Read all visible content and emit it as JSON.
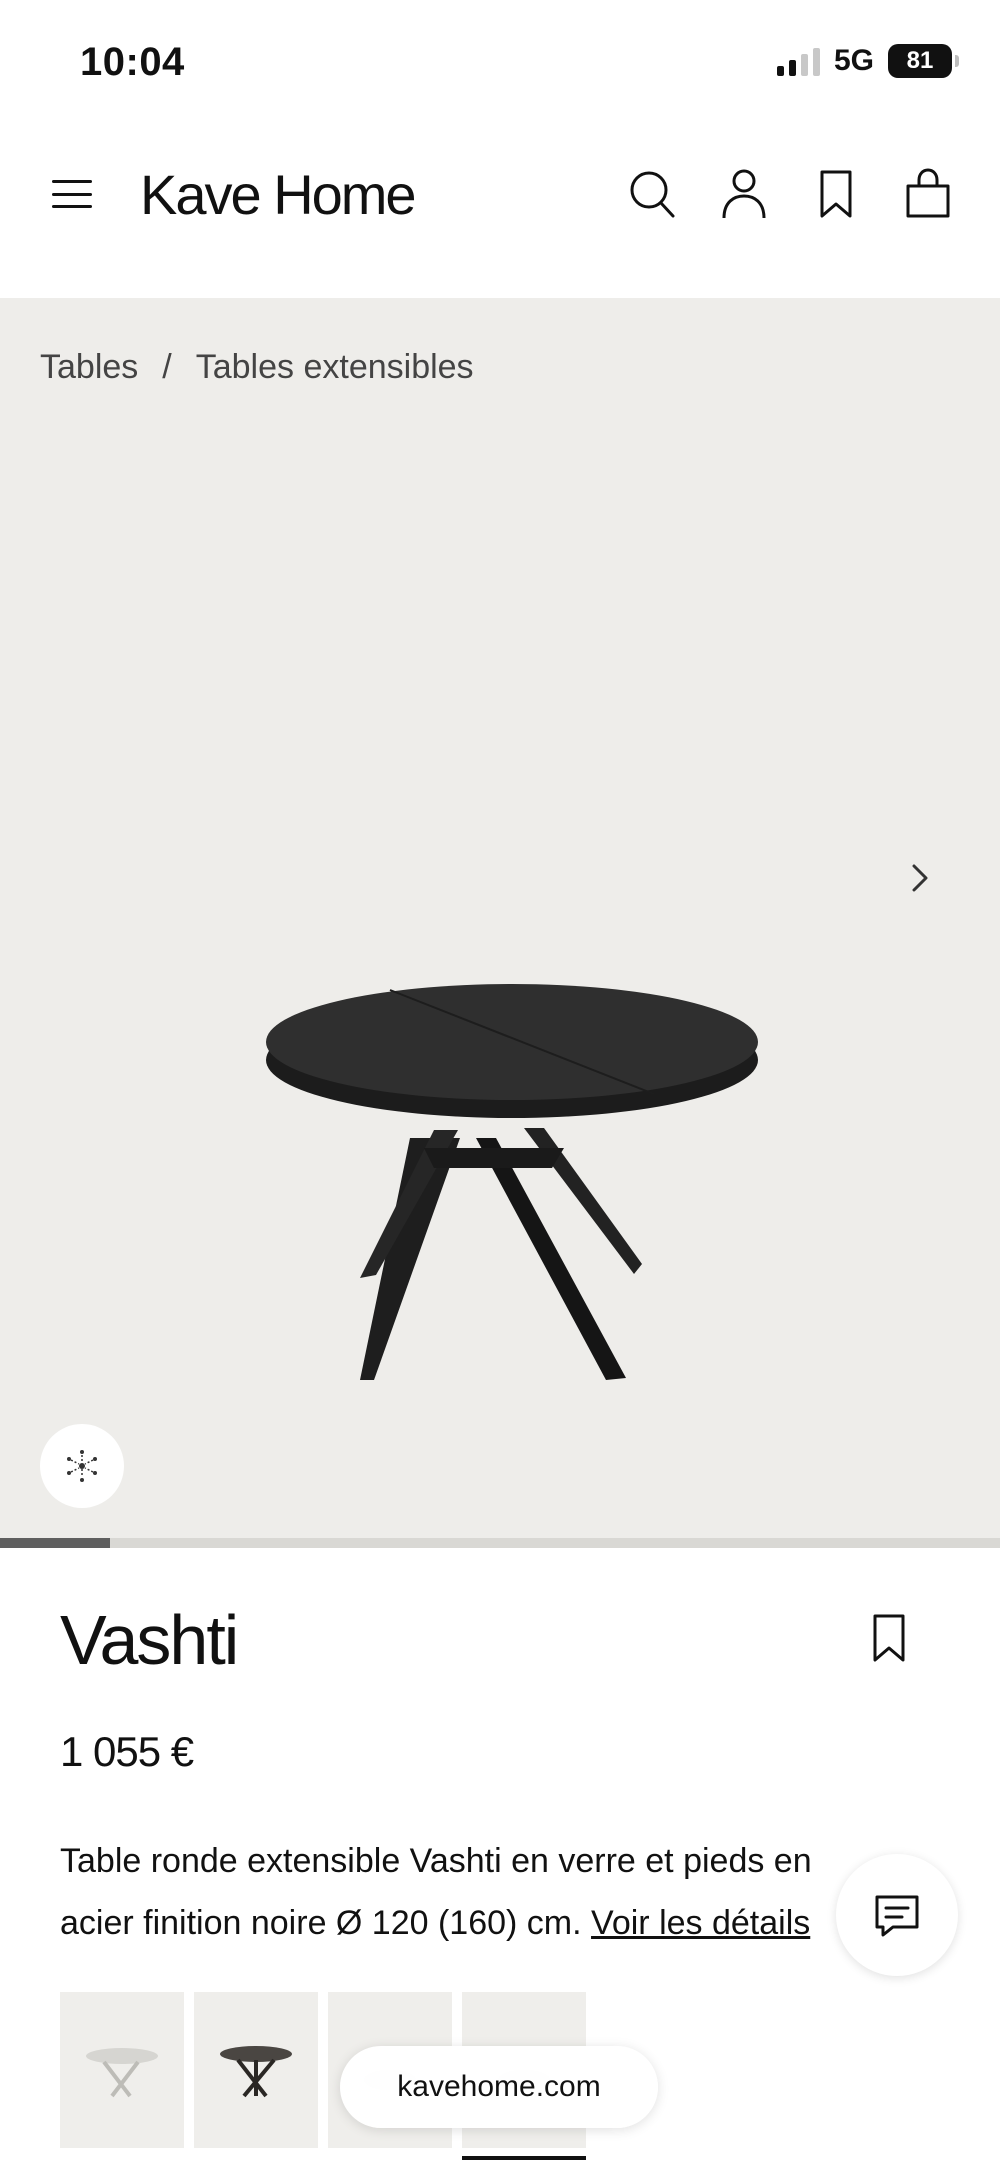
{
  "status_bar": {
    "time": "10:04",
    "network": "5G",
    "battery": "81"
  },
  "header": {
    "logo": "Kave Home",
    "icons": [
      "menu-icon",
      "search-icon",
      "account-icon",
      "bookmark-icon",
      "bag-icon"
    ]
  },
  "breadcrumb": {
    "items": [
      "Tables",
      "Tables extensibles"
    ],
    "separator": "/"
  },
  "gallery": {
    "progress_fraction": 0.11,
    "background": "#eeedea"
  },
  "product": {
    "name": "Vashti",
    "price": "1 055 €",
    "description_line1": "Table ronde extensible Vashti en verre et pieds en",
    "description_line2": "acier finition noire Ø 120 (160) cm.",
    "details_link": "Voir les détails"
  },
  "thumbnails": {
    "count": 4,
    "active_index": 3
  },
  "browser": {
    "url": "kavehome.com"
  }
}
